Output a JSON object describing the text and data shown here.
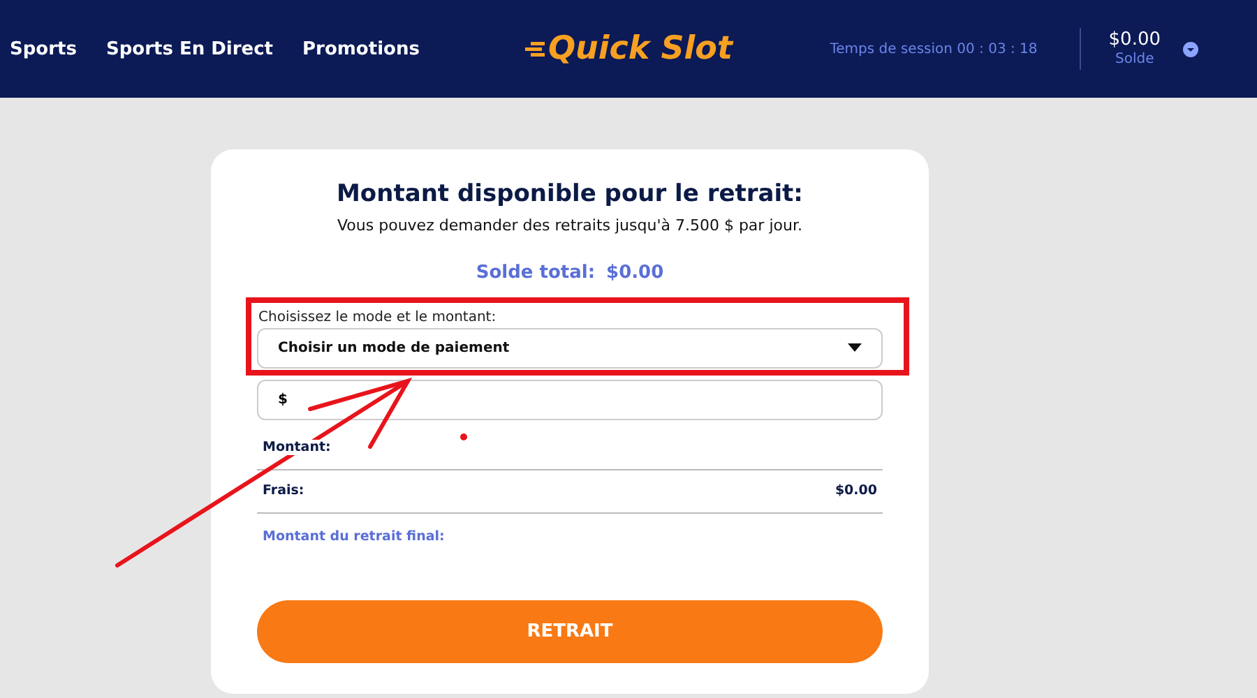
{
  "nav": {
    "items": [
      {
        "label": "Sports"
      },
      {
        "label": "Sports En Direct"
      },
      {
        "label": "Promotions"
      }
    ],
    "logo": "Quick Slot",
    "session": "Temps de session 00 : 03 : 18",
    "balance": {
      "amount": "$0.00",
      "label": "Solde"
    }
  },
  "card": {
    "title": "Montant disponible pour le retrait:",
    "subtitle": "Vous pouvez demander des retraits jusqu'à 7.500 $ par jour.",
    "total_label": "Solde total:",
    "total_value": "$0.00",
    "select_label": "Choisissez le mode et le montant:",
    "select_placeholder": "Choisir un mode de paiement",
    "amount_prefix": "$",
    "summary": [
      {
        "kind": "plain",
        "label": "Montant:"
      },
      {
        "kind": "plain",
        "label": "Frais:",
        "value": "$0.00"
      },
      {
        "kind": "accent",
        "label": "Montant du retrait final:"
      }
    ],
    "button": "RETRAIT"
  }
}
